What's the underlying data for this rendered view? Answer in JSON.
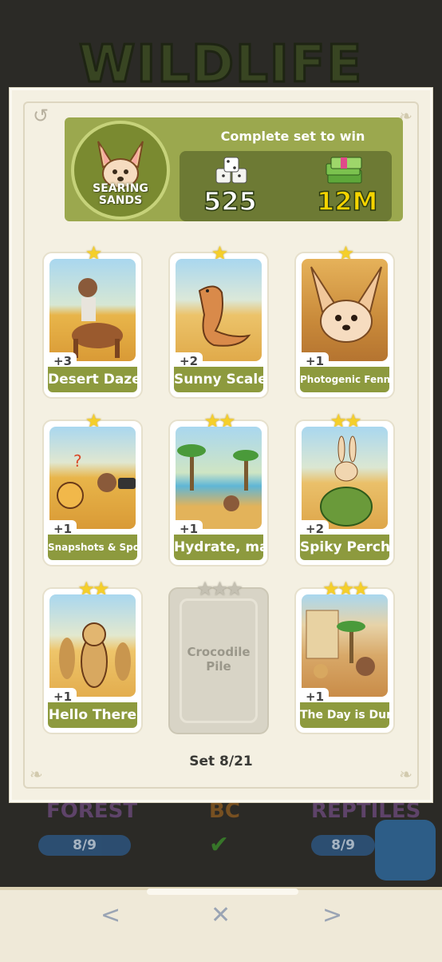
{
  "background": {
    "title": "WILDLIFE",
    "albums": [
      {
        "label": "FOREST",
        "progress": "8/9"
      },
      {
        "label": "BC",
        "progress": ""
      },
      {
        "label": "REPTILES",
        "progress": "8/9"
      }
    ]
  },
  "set": {
    "name": "SEARING SANDS",
    "complete_text": "Complete set to win",
    "reward_dice": "525",
    "reward_cash": "12M",
    "set_counter": "Set 8/21"
  },
  "cards": [
    {
      "name": "Desert Daze",
      "count": "+3",
      "stars": 1
    },
    {
      "name": "Sunny Scales",
      "count": "+2",
      "stars": 1
    },
    {
      "name": "Photogenic Fennec",
      "count": "+1",
      "stars": 1
    },
    {
      "name": "Snapshots & Spots",
      "count": "+1",
      "stars": 1
    },
    {
      "name": "Hydrate, mate!",
      "count": "+1",
      "stars": 2
    },
    {
      "name": "Spiky Perch",
      "count": "+2",
      "stars": 2
    },
    {
      "name": "Hello There",
      "count": "+1",
      "stars": 2
    },
    {
      "name": "Crocodile Pile",
      "count": "",
      "stars": 3,
      "locked": true
    },
    {
      "name": "The Day is Dune",
      "count": "+1",
      "stars": 3
    }
  ],
  "colors": {
    "header": "#9ba84e",
    "name_bar": "#8d9a3e",
    "star": "#f5cf2a"
  },
  "icons": {
    "history": "history-icon",
    "prev": "chevron-left-icon",
    "close": "close-icon",
    "next": "chevron-right-icon"
  },
  "nav": {
    "prev": "<",
    "close": "✕",
    "next": ">"
  }
}
